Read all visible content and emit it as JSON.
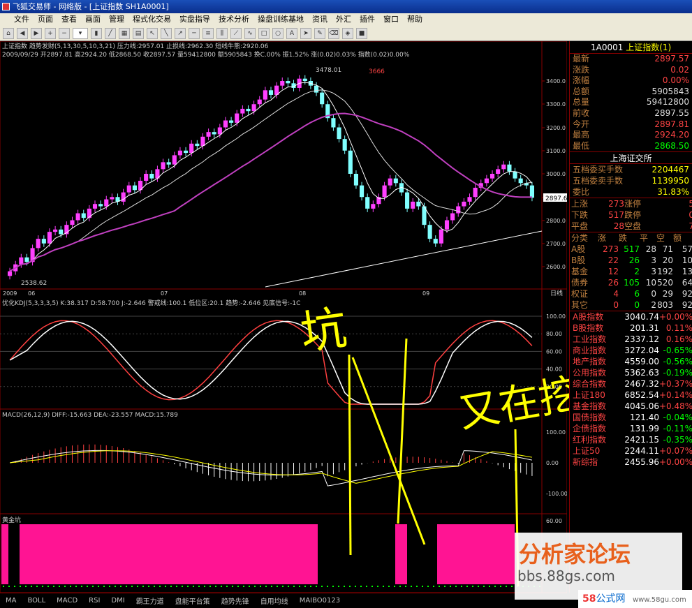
{
  "window": {
    "title": "飞狐交易师 - 网络版 - [上证指数 SH1A0001]"
  },
  "menu": [
    "文件",
    "页面",
    "查看",
    "画面",
    "管理",
    "程式化交易",
    "实盘指导",
    "技术分析",
    "操盘训练基地",
    "资讯",
    "外汇",
    "插件",
    "窗口",
    "帮助"
  ],
  "main": {
    "indicator_line": "上证指数 趋势发财(5,13,30,5,10,3,21)  压力线:2957.01  止损线:2962.30  短线牛熊:2920.06",
    "info_line": "2009/09/29 开2897.81 高2924.20 低2868.50 收2897.57 量59412800 额5905843 换C.00% 振1.52% 涨(0.02)0.03% 指数(0.02)0.00%",
    "price_labels": [
      "3400.0",
      "3300.0",
      "3200.0",
      "3100.0",
      "3000.0",
      "2900.0",
      "2800.0",
      "2700.0",
      "2600.0"
    ],
    "current_price": "2897.6",
    "hi_label": "3478.01",
    "low_label": "2538.62",
    "mark_3666": "3666",
    "date_labels": [
      "2009",
      "06",
      "07",
      "08",
      "09"
    ],
    "day_label": "日线"
  },
  "kdj": {
    "header": "优化KDJ(5,3,3,3,5)  K:38.317  D:58.700  J:-2.646  警戒线:100.1  低位区:20.1  趋势:-2.646  见底信号:-1C",
    "labels": [
      "100.00",
      "80.00",
      "60.00",
      "40.00",
      "20.00"
    ]
  },
  "macd": {
    "header": "MACD(26,12,9)  DIFF:-15.663  DEA:-23.557  MACD:15.789",
    "labels": [
      "100.00",
      "0.00",
      "-100.00"
    ]
  },
  "gold": {
    "header": "黄金坑",
    "labels": [
      "60.00",
      "0.00"
    ]
  },
  "handwriting": {
    "word1": "坑",
    "word2": "又在挖"
  },
  "bottom_tabs": [
    "MA",
    "BOLL",
    "MACD",
    "RSI",
    "DMI",
    "霸王力道",
    "盘能平台策",
    "趋势先锋",
    "自用均线",
    "MAIBO0123"
  ],
  "quote": {
    "header_code": "1A0001",
    "header_name": "上证指数(1)",
    "rows": [
      {
        "label": "最新",
        "value": "2897.57",
        "cls": "up"
      },
      {
        "label": "涨跌",
        "value": "0.02",
        "cls": "up"
      },
      {
        "label": "涨幅",
        "value": "0.00%",
        "cls": "up"
      },
      {
        "label": "总额",
        "value": "5905843",
        "cls": "w"
      },
      {
        "label": "总量",
        "value": "59412800",
        "cls": "w"
      },
      {
        "label": "前收",
        "value": "2897.55",
        "cls": "w"
      },
      {
        "label": "今开",
        "value": "2897.81",
        "cls": "up"
      },
      {
        "label": "最高",
        "value": "2924.20",
        "cls": "up"
      },
      {
        "label": "最低",
        "value": "2868.50",
        "cls": "dn"
      }
    ],
    "exchange": "上海证交所",
    "bs": [
      {
        "label": "五档委买手数",
        "value": "2204467"
      },
      {
        "label": "五档委卖手数",
        "value": "1139950"
      },
      {
        "label": "委比",
        "value": "31.83%"
      }
    ],
    "stats": [
      {
        "a": "上涨",
        "b": "273",
        "c": "涨停",
        "d": "5"
      },
      {
        "a": "下跌",
        "b": "517",
        "c": "跌停",
        "d": "0"
      },
      {
        "a": "平盘",
        "b": "28",
        "c": "空盘",
        "d": "7"
      }
    ],
    "table_header": [
      "分类",
      "涨",
      "跌",
      "平",
      "空",
      "额"
    ],
    "table": [
      [
        "A股",
        "273",
        "517",
        "28",
        "71",
        "57"
      ],
      [
        "B股",
        "22",
        "26",
        "3",
        "20",
        "10"
      ],
      [
        "基金",
        "12",
        "2",
        "3",
        "192",
        "13"
      ],
      [
        "债券",
        "26",
        "105",
        "10",
        "520",
        "64"
      ],
      [
        "权证",
        "4",
        "6",
        "0",
        "29",
        "92"
      ],
      [
        "其它",
        "0",
        "0",
        "2",
        "803",
        "92"
      ]
    ],
    "indices": [
      {
        "name": "A股指数",
        "value": "3040.74",
        "chg": "+0.00%",
        "dir": "up"
      },
      {
        "name": "B股指数",
        "value": "201.31",
        "chg": "0.11%",
        "dir": "up"
      },
      {
        "name": "工业指数",
        "value": "2337.12",
        "chg": "0.16%",
        "dir": "up"
      },
      {
        "name": "商业指数",
        "value": "3272.04",
        "chg": "-0.65%",
        "dir": "dn"
      },
      {
        "name": "地产指数",
        "value": "4559.00",
        "chg": "-0.56%",
        "dir": "dn"
      },
      {
        "name": "公用指数",
        "value": "5362.63",
        "chg": "-0.19%",
        "dir": "dn"
      },
      {
        "name": "综合指数",
        "value": "2467.32",
        "chg": "+0.37%",
        "dir": "up"
      },
      {
        "name": "上证180",
        "value": "6852.54",
        "chg": "+0.14%",
        "dir": "up"
      },
      {
        "name": "基金指数",
        "value": "4045.06",
        "chg": "+0.48%",
        "dir": "up"
      },
      {
        "name": "国债指数",
        "value": "121.40",
        "chg": "-0.04%",
        "dir": "dn"
      },
      {
        "name": "企债指数",
        "value": "131.99",
        "chg": "-0.11%",
        "dir": "dn"
      },
      {
        "name": "红利指数",
        "value": "2421.15",
        "chg": "-0.35%",
        "dir": "dn"
      },
      {
        "name": "上证50",
        "value": "2244.11",
        "chg": "+0.07%",
        "dir": "up"
      },
      {
        "name": "新综指",
        "value": "2455.96",
        "chg": "+0.00%",
        "dir": "up"
      }
    ]
  },
  "watermark": {
    "name": "分析家论坛",
    "url": "bbs.88gs.com",
    "site_a": "58",
    "site_b": "公式网",
    "site_url": "www.58gu.com"
  },
  "colors": {
    "up": "#ff4040",
    "down": "#00ff00",
    "magenta": "#ff40ff",
    "cyan": "#80ffff",
    "white": "#ffffff",
    "bg": "#000000"
  }
}
